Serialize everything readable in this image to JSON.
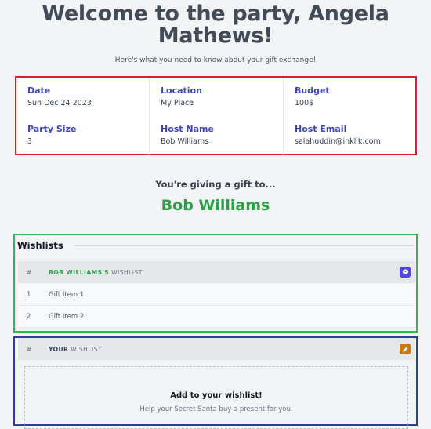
{
  "header": {
    "title": "Welcome to the party, Angela Mathews!",
    "subtitle": "Here's what you need to know about your gift exchange!"
  },
  "details": {
    "date_label": "Date",
    "date_value": "Sun Dec 24 2023",
    "location_label": "Location",
    "location_value": "My Place",
    "budget_label": "Budget",
    "budget_value": "100$",
    "party_size_label": "Party Size",
    "party_size_value": "3",
    "host_name_label": "Host Name",
    "host_name_value": "Bob Williams",
    "host_email_label": "Host Email",
    "host_email_value": "salahuddin@inklik.com"
  },
  "giving": {
    "label": "You're giving a gift to...",
    "recipient": "Bob Williams"
  },
  "wishlists": {
    "title": "Wishlists",
    "recipient_list": {
      "hash": "#",
      "owner": "BOB WILLIAMS'S",
      "suffix": "WISHLIST",
      "items": [
        {
          "num": "1",
          "name": "Gift Item 1"
        },
        {
          "num": "2",
          "name": "Gift Item 2"
        }
      ]
    },
    "your_list": {
      "hash": "#",
      "owner": "YOUR",
      "suffix": "WISHLIST",
      "empty_title": "Add to your wishlist!",
      "empty_subtitle": "Help your Secret Santa buy a present for you."
    }
  },
  "colors": {
    "info_border": "#e11d2a",
    "wishlists_border": "#34b555",
    "your_wishlist_border": "#2b3fa0",
    "label_blue": "#3b46b8",
    "recipient_green": "#2e9e47"
  },
  "icons": {
    "message_button": "chat-bubble-icon",
    "edit_button": "pencil-icon"
  }
}
